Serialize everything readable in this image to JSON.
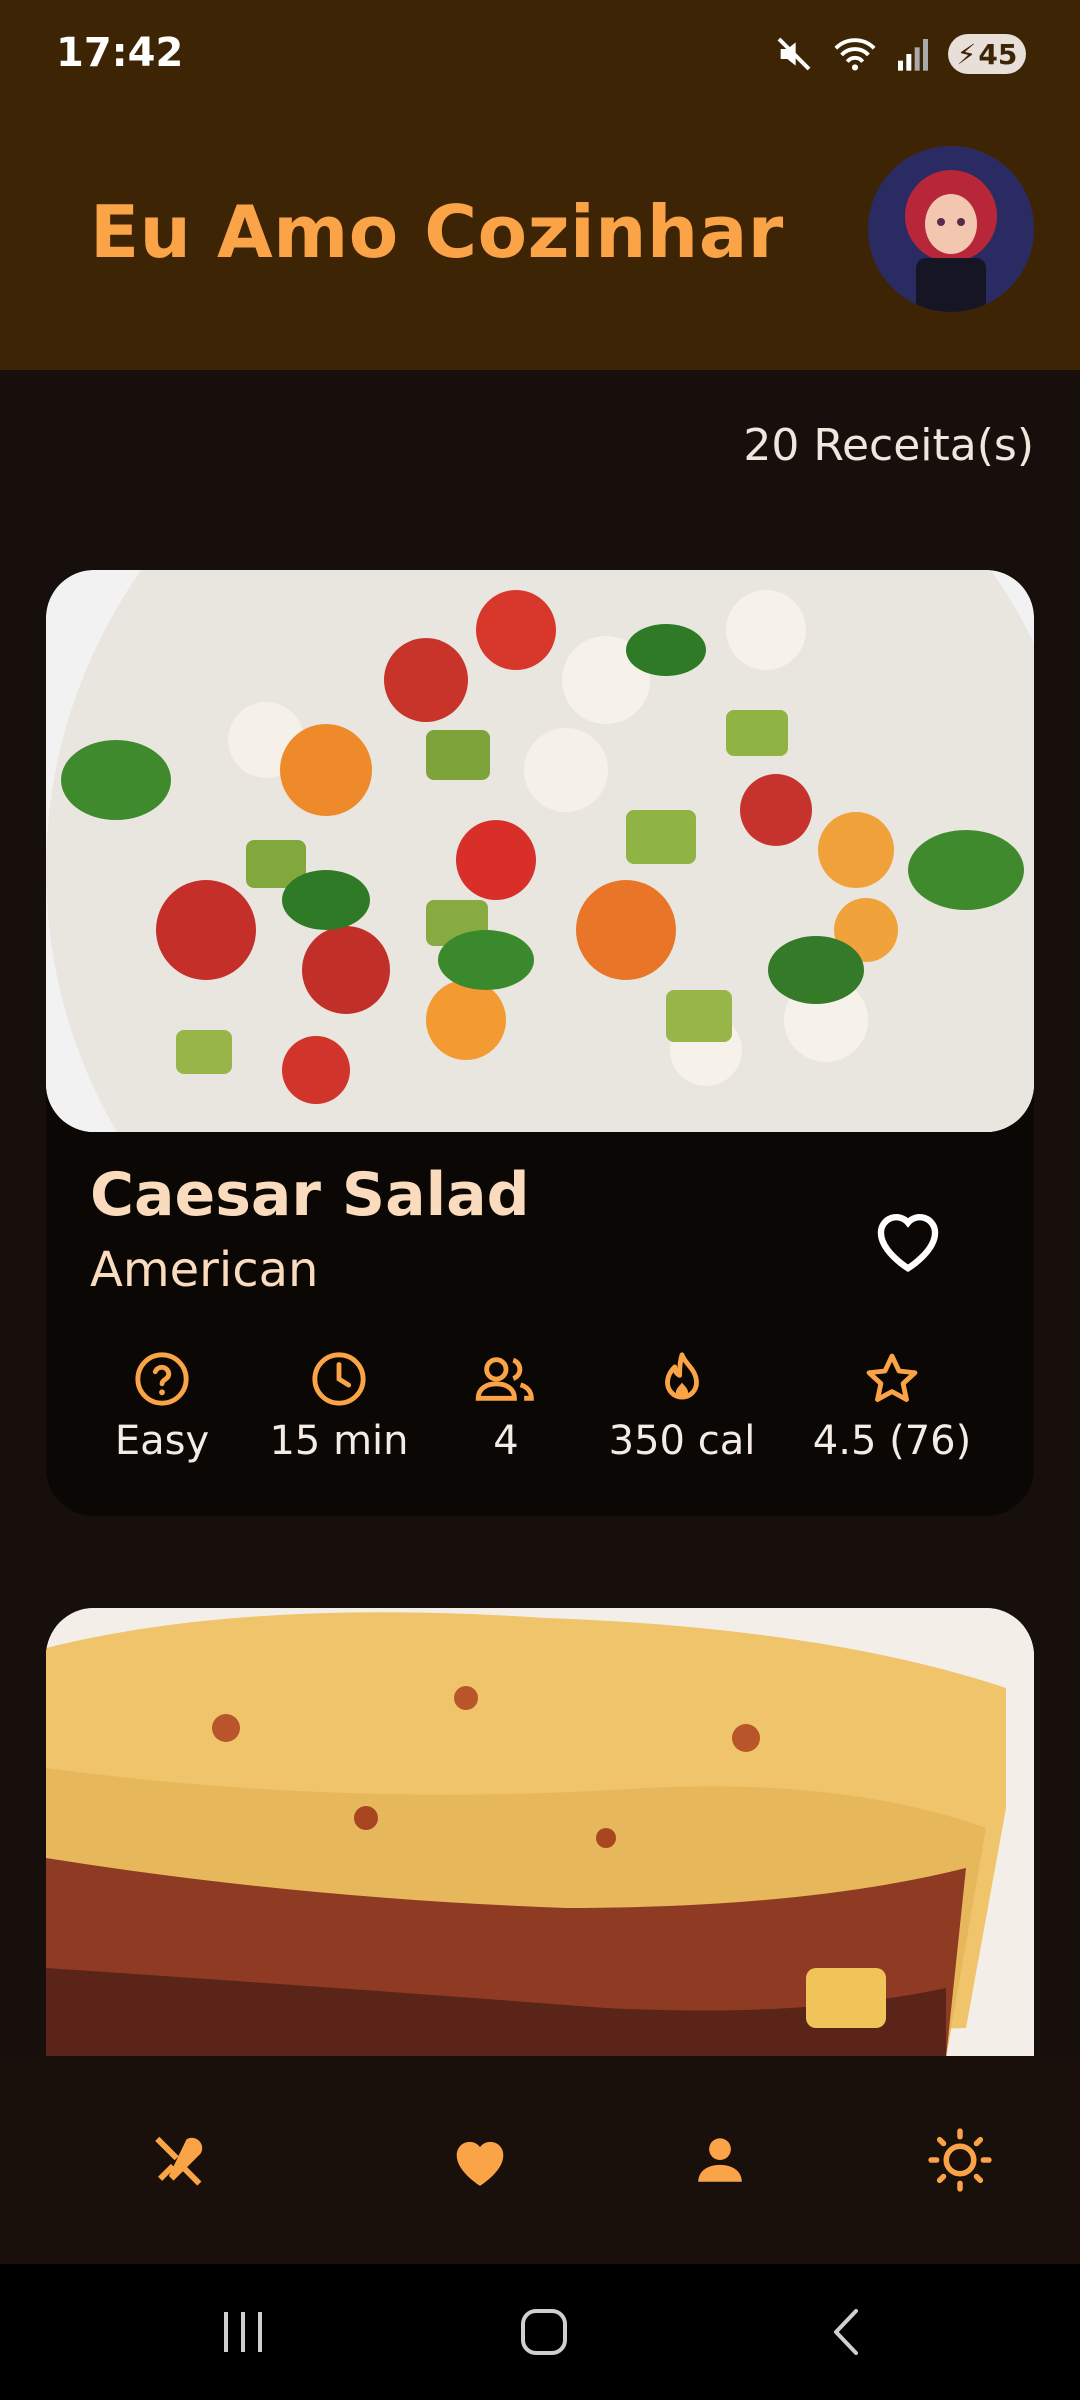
{
  "status_bar": {
    "time": "17:42",
    "battery": "45"
  },
  "app_bar": {
    "title": "Eu Amo Cozinhar"
  },
  "recipe_count": "20 Receita(s)",
  "recipes": [
    {
      "title": "Caesar Salad",
      "cuisine": "American",
      "difficulty": "Easy",
      "time": "15 min",
      "servings": "4",
      "calories": "350 cal",
      "rating": "4.5 (76)"
    }
  ],
  "colors": {
    "accent": "#fba447",
    "header_bg": "#3d2405",
    "card_text": "#fbdbbd"
  },
  "bottom_nav": [
    "recipes-icon",
    "favorites-icon",
    "profile-icon",
    "theme-icon"
  ]
}
